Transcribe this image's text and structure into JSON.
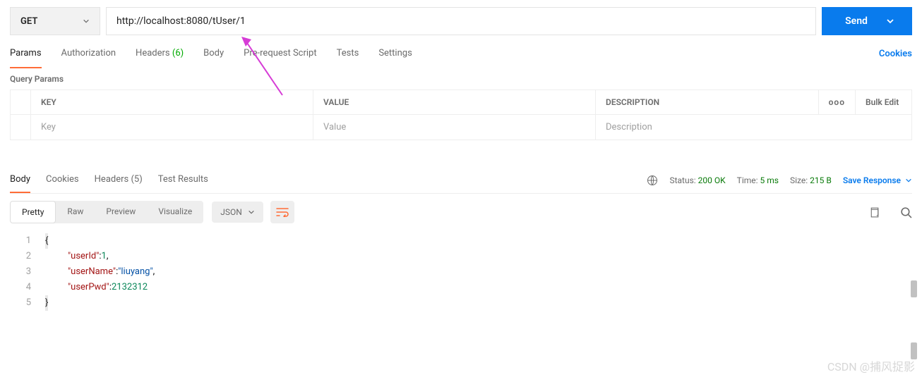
{
  "request": {
    "method": "GET",
    "url": "http://localhost:8080/tUser/1",
    "send_label": "Send"
  },
  "tabs": {
    "params": "Params",
    "auth": "Authorization",
    "headers": "Headers",
    "headers_count": "(6)",
    "body": "Body",
    "prerequest": "Pre-request Script",
    "tests": "Tests",
    "settings": "Settings",
    "cookies": "Cookies"
  },
  "params_section": {
    "title": "Query Params",
    "key_h": "KEY",
    "val_h": "VALUE",
    "desc_h": "DESCRIPTION",
    "dots": "ooo",
    "bulk": "Bulk Edit",
    "key_ph": "Key",
    "val_ph": "Value",
    "desc_ph": "Description"
  },
  "response_tabs": {
    "body": "Body",
    "cookies": "Cookies",
    "headers": "Headers",
    "headers_count": "(5)",
    "test_results": "Test Results"
  },
  "response_meta": {
    "status_label": "Status:",
    "status_value": "200 OK",
    "time_label": "Time:",
    "time_value": "5 ms",
    "size_label": "Size:",
    "size_value": "215 B",
    "save": "Save Response"
  },
  "view": {
    "pretty": "Pretty",
    "raw": "Raw",
    "preview": "Preview",
    "visualize": "Visualize",
    "format": "JSON"
  },
  "code": {
    "l1": "{",
    "l2k": "\"userId\"",
    "l2v": "1",
    "l3k": "\"userName\"",
    "l3v": "\"liuyang\"",
    "l4k": "\"userPwd\"",
    "l4v": "2132312",
    "l5": "}"
  },
  "watermark": "CSDN @捕风捉影"
}
